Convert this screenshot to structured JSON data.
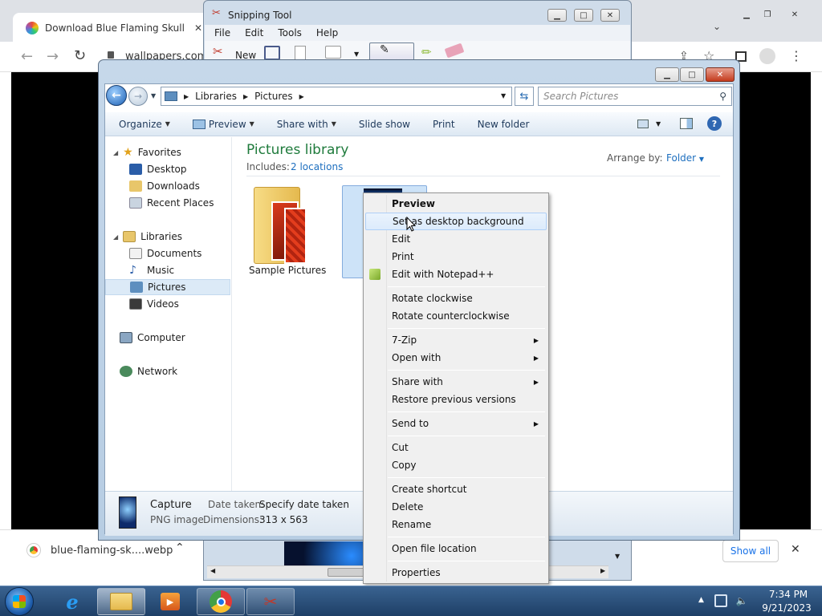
{
  "chrome": {
    "tab_title": "Download Blue Flaming Skull Of",
    "tab_close": "✕",
    "address": "wallpapers.com",
    "download_file": "blue-flaming-sk....webp",
    "show_all": "Show all",
    "close_bar": "✕"
  },
  "snipping": {
    "title": "Snipping Tool",
    "menu": [
      "File",
      "Edit",
      "Tools",
      "Help"
    ],
    "new_label": "New"
  },
  "explorer": {
    "breadcrumb": [
      "Libraries",
      "Pictures"
    ],
    "search_placeholder": "Search Pictures",
    "commands": [
      "Organize",
      "Preview",
      "Share with",
      "Slide show",
      "Print",
      "New folder"
    ],
    "nav": {
      "favorites": "Favorites",
      "desktop": "Desktop",
      "downloads": "Downloads",
      "recent": "Recent Places",
      "libraries": "Libraries",
      "documents": "Documents",
      "music": "Music",
      "pictures": "Pictures",
      "videos": "Videos",
      "computer": "Computer",
      "network": "Network"
    },
    "library_title": "Pictures library",
    "includes_label": "Includes:",
    "includes_link": "2 locations",
    "arrange_label": "Arrange by:",
    "arrange_value": "Folder",
    "folder_name": "Sample Pictures",
    "details": {
      "name": "Capture",
      "type": "PNG image",
      "date_label": "Date taken:",
      "date_value": "Specify date taken",
      "dim_label": "Dimensions:",
      "dim_value": "313 x 563"
    }
  },
  "context_menu": {
    "items": [
      "Preview",
      "Set as desktop background",
      "Edit",
      "Print",
      "Edit with Notepad++",
      "Rotate clockwise",
      "Rotate counterclockwise",
      "7-Zip",
      "Open with",
      "Share with",
      "Restore previous versions",
      "Send to",
      "Cut",
      "Copy",
      "Create shortcut",
      "Delete",
      "Rename",
      "Open file location",
      "Properties"
    ]
  },
  "taskbar": {
    "time": "7:34 PM",
    "date": "9/21/2023"
  },
  "colors": {
    "accent_blue": "#1e6fbf",
    "library_green": "#1f7b3c",
    "taskbar": "#1e3f66"
  }
}
